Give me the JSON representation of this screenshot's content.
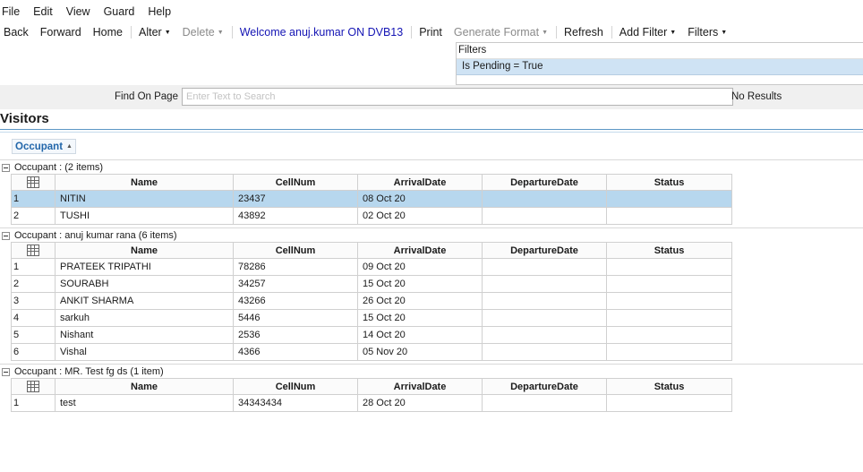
{
  "menu": [
    "File",
    "Edit",
    "View",
    "Guard",
    "Help"
  ],
  "toolbar": {
    "back": "Back",
    "forward": "Forward",
    "home": "Home",
    "alter": "Alter",
    "delete": "Delete",
    "welcome": "Welcome anuj.kumar ON DVB13",
    "print": "Print",
    "generate_format": "Generate Format",
    "refresh": "Refresh",
    "add_filter": "Add Filter",
    "filters": "Filters"
  },
  "filters_panel": {
    "title": "Filters",
    "items": [
      "Is Pending  = True"
    ]
  },
  "find": {
    "label": "Find On Page",
    "placeholder": "Enter Text to Search",
    "result": "No Results"
  },
  "page_title": "Visitors",
  "group_by": "Occupant",
  "columns": [
    "Name",
    "CellNum",
    "ArrivalDate",
    "DepartureDate",
    "Status"
  ],
  "groups": [
    {
      "header": "Occupant :  (2 items)",
      "rows": [
        {
          "n": "1",
          "name": "NITIN",
          "cell": "23437",
          "arrival": "08 Oct 20",
          "departure": "",
          "status": "",
          "selected": true
        },
        {
          "n": "2",
          "name": "TUSHI",
          "cell": "43892",
          "arrival": "02 Oct 20",
          "departure": "",
          "status": ""
        }
      ]
    },
    {
      "header": "Occupant : anuj kumar rana (6 items)",
      "rows": [
        {
          "n": "1",
          "name": "PRATEEK TRIPATHI",
          "cell": "78286",
          "arrival": "09 Oct 20",
          "departure": "",
          "status": ""
        },
        {
          "n": "2",
          "name": "SOURABH",
          "cell": "34257",
          "arrival": "15 Oct 20",
          "departure": "",
          "status": ""
        },
        {
          "n": "3",
          "name": "ANKIT SHARMA",
          "cell": "43266",
          "arrival": "26 Oct 20",
          "departure": "",
          "status": ""
        },
        {
          "n": "4",
          "name": "sarkuh",
          "cell": "5446",
          "arrival": "15 Oct 20",
          "departure": "",
          "status": ""
        },
        {
          "n": "5",
          "name": "Nishant",
          "cell": "2536",
          "arrival": "14 Oct 20",
          "departure": "",
          "status": ""
        },
        {
          "n": "6",
          "name": "Vishal",
          "cell": "4366",
          "arrival": "05 Nov 20",
          "departure": "",
          "status": ""
        }
      ]
    },
    {
      "header": "Occupant : MR. Test fg ds (1 item)",
      "rows": [
        {
          "n": "1",
          "name": "test",
          "cell": "34343434",
          "arrival": "28 Oct 20",
          "departure": "",
          "status": ""
        }
      ]
    }
  ]
}
